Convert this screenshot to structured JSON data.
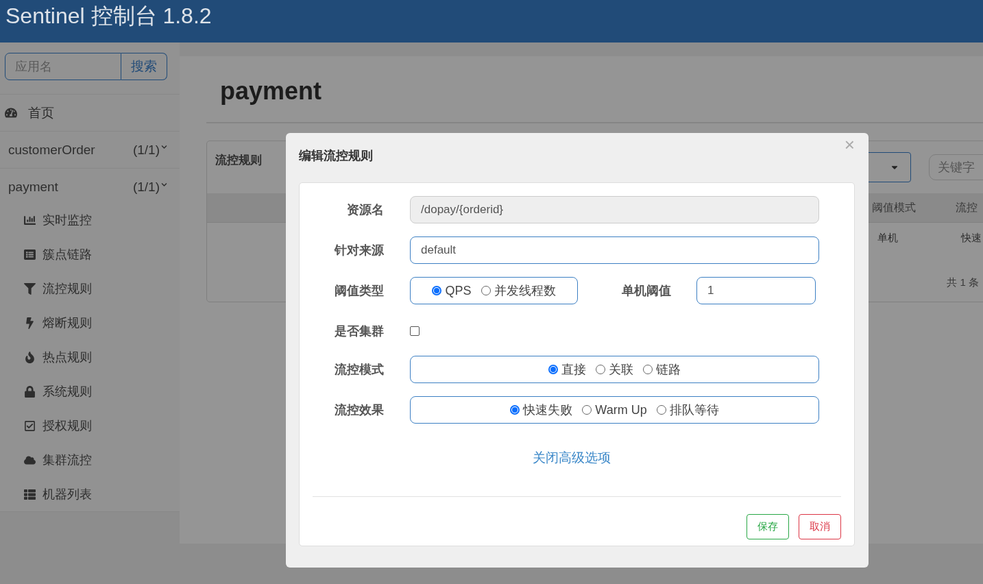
{
  "header": {
    "title": "Sentinel 控制台 1.8.2"
  },
  "sidebar": {
    "search": {
      "placeholder": "应用名",
      "button": "搜索"
    },
    "home": "首页",
    "apps": [
      {
        "name": "customerOrder",
        "count": "(1/1)",
        "expanded": false
      },
      {
        "name": "payment",
        "count": "(1/1)",
        "expanded": true,
        "children": [
          {
            "label": "实时监控"
          },
          {
            "label": "簇点链路"
          },
          {
            "label": "流控规则"
          },
          {
            "label": "熔断规则"
          },
          {
            "label": "热点规则"
          },
          {
            "label": "系统规则"
          },
          {
            "label": "授权规则"
          },
          {
            "label": "集群流控"
          },
          {
            "label": "机器列表"
          }
        ]
      }
    ]
  },
  "main": {
    "title": "payment",
    "card": {
      "title": "流控规则",
      "search": {
        "placeholder": "关键字"
      },
      "columns": [
        "阈值模式",
        "流控"
      ],
      "rows": [
        [
          "单机",
          "快速"
        ]
      ],
      "footer": "共 1 条"
    }
  },
  "dialog": {
    "title": "编辑流控规则",
    "close": "×",
    "fields": [
      {
        "kind": "text",
        "label": "资源名",
        "value": "/dopay/{orderid}",
        "disabled": true
      },
      {
        "kind": "text",
        "label": "针对来源",
        "value": "default",
        "disabled": false
      },
      {
        "kind": "threshold",
        "label": "阈值类型",
        "options": [
          {
            "label": "QPS",
            "selected": true
          },
          {
            "label": "并发线程数",
            "selected": false
          }
        ],
        "extra": {
          "label": "单机阈值",
          "value": "1"
        }
      },
      {
        "kind": "checkbox",
        "label": "是否集群",
        "checked": false
      },
      {
        "kind": "radio",
        "label": "流控模式",
        "options": [
          {
            "label": "直接",
            "selected": true
          },
          {
            "label": "关联",
            "selected": false
          },
          {
            "label": "链路",
            "selected": false
          }
        ]
      },
      {
        "kind": "radio",
        "label": "流控效果",
        "options": [
          {
            "label": "快速失败",
            "selected": true
          },
          {
            "label": "Warm Up",
            "selected": false
          },
          {
            "label": "排队等待",
            "selected": false
          }
        ]
      }
    ],
    "link": "关闭高级选项",
    "buttons": [
      {
        "label": "保存",
        "kind": "save"
      },
      {
        "label": "取消",
        "kind": "cancel"
      }
    ]
  }
}
